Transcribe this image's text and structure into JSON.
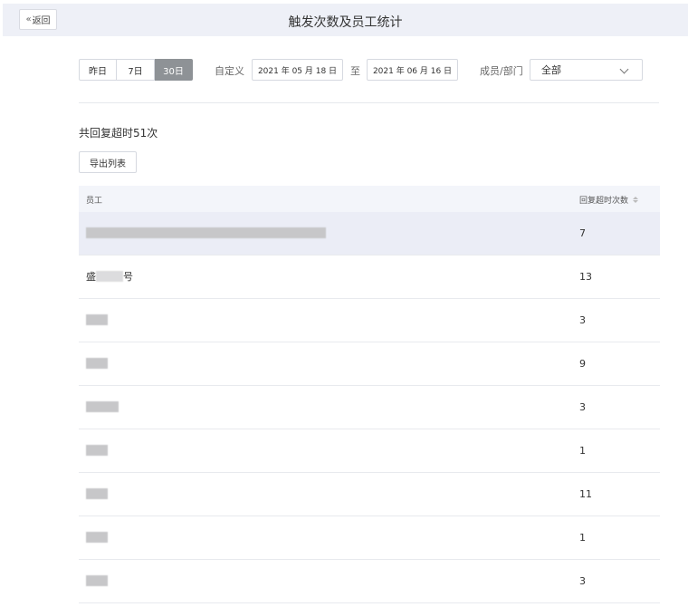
{
  "header": {
    "back_label": "返回",
    "title": "触发次数及员工统计"
  },
  "filters": {
    "range_buttons": [
      "昨日",
      "7日",
      "30日"
    ],
    "active_range": "30日",
    "custom_label": "自定义",
    "start_date": "2021 年 05 月 18 日",
    "to_label": "至",
    "end_date": "2021 年 06 月 16 日",
    "member_label": "成员/部门",
    "member_value": "全部"
  },
  "summary": {
    "text": "共回复超时51次",
    "export_label": "导出列表"
  },
  "table": {
    "col_employee": "员工",
    "col_count": "回复超时次数",
    "rows": [
      {
        "name_prefix": "",
        "name_suffix": "",
        "count": "7"
      },
      {
        "name_prefix": "盛",
        "name_suffix": "号",
        "count": "13"
      },
      {
        "name_prefix": "",
        "name_suffix": "",
        "count": "3"
      },
      {
        "name_prefix": "",
        "name_suffix": "",
        "count": "9"
      },
      {
        "name_prefix": "",
        "name_suffix": "",
        "count": "3"
      },
      {
        "name_prefix": "",
        "name_suffix": "",
        "count": "1"
      },
      {
        "name_prefix": "",
        "name_suffix": "",
        "count": "11"
      },
      {
        "name_prefix": "",
        "name_suffix": "",
        "count": "1"
      },
      {
        "name_prefix": "",
        "name_suffix": "",
        "count": "3"
      }
    ]
  }
}
